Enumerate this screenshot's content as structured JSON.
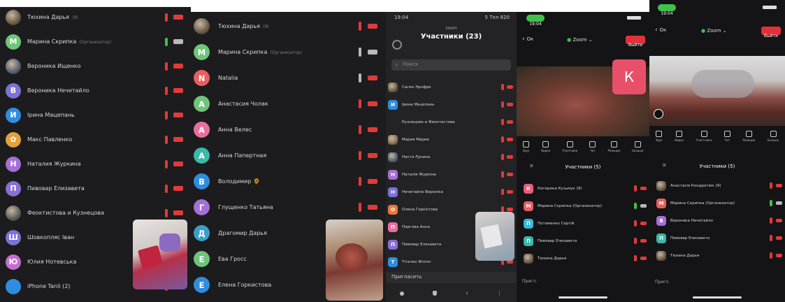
{
  "colors": {
    "bg": "#1c1c1e",
    "muted": "#e23a3a",
    "accent": "#2d8cff",
    "green": "#3fc24a",
    "leave": "#e0303a"
  },
  "panel1": {
    "rows": [
      {
        "initial": "",
        "name": "Тюхина Дарья",
        "sub": "(Я)",
        "color": "#6b5a47",
        "avatar_type": "photo",
        "mic": "muted",
        "cam": "off"
      },
      {
        "initial": "М",
        "name": "Марина Скрипка",
        "sub": "(Организатор)",
        "color": "#6fc57a",
        "mic": "green",
        "cam": "on"
      },
      {
        "initial": "",
        "name": "Вероника Ищенко",
        "sub": "",
        "color": "#55606e",
        "avatar_type": "photo",
        "mic": "muted",
        "cam": "off"
      },
      {
        "initial": "В",
        "name": "Вероника Нечитайло",
        "sub": "",
        "color": "#7b73d6",
        "mic": "muted",
        "cam": "off"
      },
      {
        "initial": "И",
        "name": "Ірина Мацепань",
        "sub": "",
        "color": "#2f8de0",
        "mic": "muted",
        "cam": "off"
      },
      {
        "initial": "",
        "name": "Макс Павленко",
        "sub": "",
        "color": "#e0a43a",
        "avatar_type": "emoji",
        "mic": "muted",
        "cam": "off"
      },
      {
        "initial": "Н",
        "name": "Наталия Журкина",
        "sub": "",
        "color": "#a570d6",
        "mic": "muted",
        "cam": "off"
      },
      {
        "initial": "П",
        "name": "Пивовар Елизавета",
        "sub": "",
        "color": "#8a6fd6",
        "mic": "muted",
        "cam": "off"
      },
      {
        "initial": "",
        "name": "Феоктистова и Кузнецова",
        "sub": "",
        "color": "#5a5a5a",
        "avatar_type": "photo",
        "mic": "muted",
        "cam": "off"
      },
      {
        "initial": "Ш",
        "name": "Шовкопляс Іван",
        "sub": "",
        "color": "#7b73d6",
        "mic": "muted",
        "cam": "off"
      },
      {
        "initial": "Ю",
        "name": "Юлия Нотевська",
        "sub": "",
        "color": "#c46fd0",
        "mic": "muted",
        "cam": "off"
      },
      {
        "initial": "",
        "name": "iPhone Tanli (2)",
        "sub": "",
        "color": "#2f8de0",
        "mic": "muted",
        "cam": "off"
      }
    ]
  },
  "panel2": {
    "rows": [
      {
        "initial": "",
        "name": "Тюхина Дарья",
        "sub": "(Я)",
        "color": "#6b5a47",
        "avatar_type": "photo",
        "mic": "muted",
        "cam": "off"
      },
      {
        "initial": "М",
        "name": "Марина Скрипка",
        "sub": "(Организатор)",
        "color": "#6fc57a",
        "mic": "on",
        "cam": "on"
      },
      {
        "initial": "N",
        "name": "Natalia",
        "sub": "",
        "color": "#e85f5f",
        "mic": "on",
        "cam": "off"
      },
      {
        "initial": "А",
        "name": "Анастасия Чолак",
        "sub": "",
        "color": "#6fc57a",
        "mic": "muted",
        "cam": "off"
      },
      {
        "initial": "А",
        "name": "Анна Велес",
        "sub": "",
        "color": "#e86fa0",
        "mic": "muted",
        "cam": "off"
      },
      {
        "initial": "А",
        "name": "Анна Папертная",
        "sub": "",
        "color": "#3ab8a8",
        "mic": "muted",
        "cam": "off"
      },
      {
        "initial": "В",
        "name": "Володимир 🌻",
        "sub": "",
        "color": "#2f8de0",
        "mic": "muted",
        "cam": "off"
      },
      {
        "initial": "Г",
        "name": "Глущенко Татьяна",
        "sub": "",
        "color": "#a570d6",
        "mic": "muted",
        "cam": "off"
      },
      {
        "initial": "Д",
        "name": "Драгомир Дарья",
        "sub": "",
        "color": "#3aa0c8",
        "mic": "muted",
        "cam": "off"
      },
      {
        "initial": "Е",
        "name": "Ева Гросс",
        "sub": "",
        "color": "#6fc57a",
        "mic": "muted",
        "cam": "off"
      },
      {
        "initial": "Е",
        "name": "Елена Горкистова",
        "sub": "",
        "color": "#2f8de0",
        "mic": "muted",
        "cam": "off"
      }
    ]
  },
  "panel3": {
    "status_time": "19:04",
    "status_right": "5 Тел 820",
    "header_small": "zoom",
    "title": "Участники (23)",
    "search_placeholder": "Поиск",
    "rows": [
      {
        "initial": "",
        "name": "Сагин Эрнфре",
        "color": "#6b5a47",
        "avatar_type": "photo",
        "mic": "muted",
        "cam": "off"
      },
      {
        "initial": "И",
        "name": "Ірина Мацепань",
        "color": "#2f8de0",
        "mic": "muted",
        "cam": "off"
      },
      {
        "initial": "",
        "name": "Кузнецова и Феоктистова",
        "color": "#1c1c1e",
        "avatar_type": "none",
        "mic": "muted",
        "cam": "off"
      },
      {
        "initial": "",
        "name": "Мария Мария",
        "color": "#8a7355",
        "avatar_type": "photo",
        "mic": "muted",
        "cam": "off"
      },
      {
        "initial": "",
        "name": "Настя Лукина",
        "color": "#55606e",
        "avatar_type": "photo",
        "mic": "muted",
        "cam": "off"
      },
      {
        "initial": "Н",
        "name": "Наталія Журкіна",
        "color": "#a570d6",
        "mic": "muted",
        "cam": "off"
      },
      {
        "initial": "Н",
        "name": "Нечитайло Вероніка",
        "color": "#7b73d6",
        "mic": "muted",
        "cam": "off"
      },
      {
        "initial": "О",
        "name": "Олена Горкістова",
        "color": "#e87a3a",
        "mic": "muted",
        "cam": "off"
      },
      {
        "initial": "П",
        "name": "Паргова Анна",
        "color": "#e86fa0",
        "mic": "muted",
        "cam": "off"
      },
      {
        "initial": "П",
        "name": "Пивовар Елизавета",
        "color": "#8a6fd6",
        "mic": "muted",
        "cam": "off"
      },
      {
        "initial": "Т",
        "name": "Тітечко Філіпп",
        "color": "#2f8de0",
        "mic": "muted",
        "cam": "off"
      }
    ],
    "invite_label": "Пригласить",
    "bottom_icons": [
      "record-icon",
      "shield-icon",
      "share-icon",
      "more-icon"
    ]
  },
  "panel4": {
    "time_pill": "19:04",
    "back_label": "Ок",
    "zoom_label": "Zoom",
    "leave_label": "Выйти",
    "big_initial": "К",
    "big_initial_color": "#e8506a",
    "toolbar": [
      "Звук",
      "Видео",
      "Участники",
      "Чат",
      "Реакции",
      "Больше"
    ],
    "list_title": "Участники (5)",
    "rows": [
      {
        "initial": "К",
        "name": "Катерина Кузьмук (Я)",
        "color": "#e85f7a",
        "mic": "muted",
        "cam": "off"
      },
      {
        "initial": "М",
        "name": "Марина Скрипка (Организатор)",
        "color": "#e85f5f",
        "mic": "green",
        "cam": "on"
      },
      {
        "initial": "П",
        "name": "Потаменко Сергій",
        "color": "#3ab8d8",
        "mic": "muted",
        "cam": "off"
      },
      {
        "initial": "П",
        "name": "Пивовар Елизавета",
        "color": "#3ab8a8",
        "mic": "muted",
        "cam": "off"
      },
      {
        "initial": "",
        "name": "Тюхина Дарья",
        "color": "#6b5a47",
        "avatar_type": "photo",
        "mic": "muted",
        "cam": "off"
      }
    ],
    "footer_left": "Пригл."
  },
  "panel5": {
    "time_pill": "19:04",
    "back_label": "Ок",
    "zoom_label": "Zoom",
    "leave_label": "Выйти",
    "toolbar": [
      "Звук",
      "Видео",
      "Участники",
      "Чат",
      "Реакции",
      "Больше"
    ],
    "list_title": "Участники (5)",
    "rows": [
      {
        "initial": "",
        "name": "Анастасія Кондратюк (Я)",
        "color": "#6b5a47",
        "avatar_type": "photo",
        "mic": "muted",
        "cam": "off"
      },
      {
        "initial": "М",
        "name": "Марина Скрипка (Организатор)",
        "color": "#e85f5f",
        "mic": "green",
        "cam": "on"
      },
      {
        "initial": "В",
        "name": "Вероника Нечитайло",
        "color": "#a570d6",
        "mic": "muted",
        "cam": "off"
      },
      {
        "initial": "П",
        "name": "Пивовар Елизавета",
        "color": "#3ab8a8",
        "mic": "muted",
        "cam": "off"
      },
      {
        "initial": "",
        "name": "Тюхина Дарья",
        "color": "#6b5a47",
        "avatar_type": "photo",
        "mic": "muted",
        "cam": "off"
      }
    ],
    "footer_left": "Пригл."
  }
}
